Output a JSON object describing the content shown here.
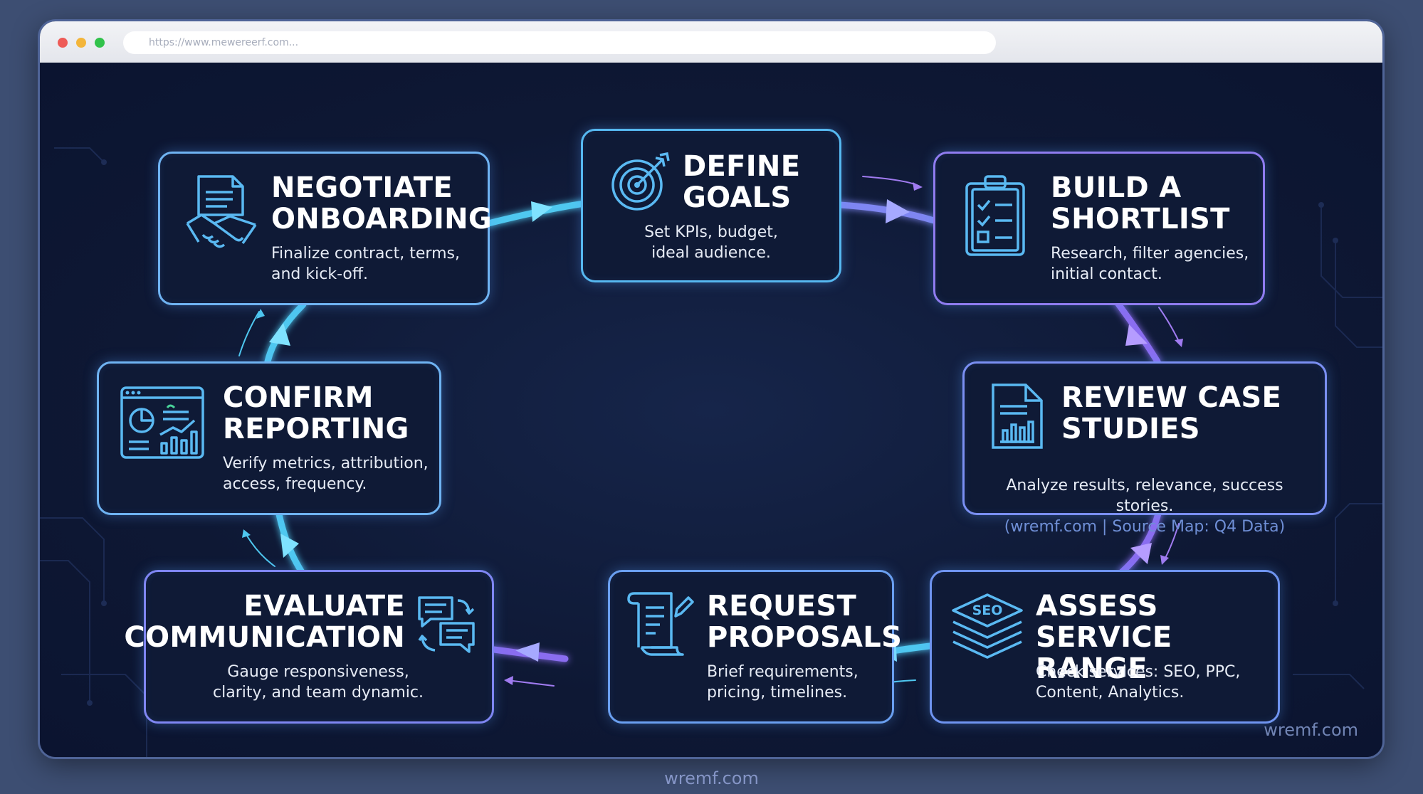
{
  "browser": {
    "url": "https://www.mewereerf.com..."
  },
  "colors": {
    "background": "#3d4e72",
    "canvas": "#0f1a36",
    "card_border_cyan": "#4fd3f5",
    "card_border_purple": "#a07bf0",
    "flow_arrow_cyan": "#4fc8f0",
    "flow_arrow_purple": "#8a6df0",
    "accent_text": "#6f8fd6"
  },
  "steps": [
    {
      "id": "define-goals",
      "title": "DEFINE\nGOALS",
      "description": "Set KPIs, budget,\nideal audience.",
      "icon": "target-icon"
    },
    {
      "id": "build-shortlist",
      "title": "BUILD A\nSHORTLIST",
      "description": "Research, filter agencies,\ninitial contact.",
      "icon": "clipboard-checklist-icon"
    },
    {
      "id": "review-case-studies",
      "title": "REVIEW CASE\nSTUDIES",
      "description": "Analyze results, relevance, success\nstories.",
      "source_note": "(wremf.com | Source Map: Q4 Data)",
      "icon": "document-chart-icon"
    },
    {
      "id": "assess-service-range",
      "title": "ASSESS\nSERVICE RANGE",
      "description": "Check services: SEO, PPC,\nContent, Analytics.",
      "icon": "seo-layers-icon",
      "icon_text": "SEO"
    },
    {
      "id": "request-proposals",
      "title": "REQUEST\nPROPOSALS",
      "description": "Brief requirements,\npricing, timelines.",
      "icon": "scroll-pen-icon"
    },
    {
      "id": "evaluate-communication",
      "title": "EVALUATE\nCOMMUNICATION",
      "description": "Gauge responsiveness,\nclarity, and team dynamic.",
      "icon": "chat-bubbles-icon"
    },
    {
      "id": "confirm-reporting",
      "title": "CONFIRM\nREPORTING",
      "description": "Verify metrics, attribution,\naccess, frequency.",
      "icon": "dashboard-icon"
    },
    {
      "id": "negotiate-onboarding",
      "title": "NEGOTIATE\nONBOARDING",
      "description": "Finalize contract, terms,\nand kick-off.",
      "icon": "handshake-contract-icon"
    }
  ],
  "watermark": "wremf.com",
  "footer": "wremf.com"
}
